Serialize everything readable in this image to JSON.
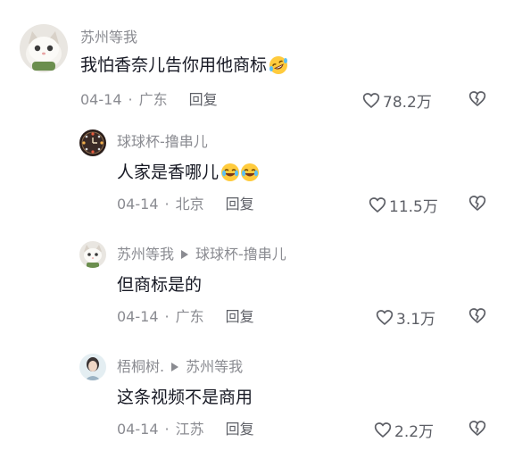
{
  "comments": [
    {
      "author": "苏州等我",
      "reply_to": "",
      "text": "我怕香奈儿告你用他商标",
      "emojis": [
        "rofl-emoji"
      ],
      "date": "04-14",
      "location": "广东",
      "reply_label": "回复",
      "likes": "78.2万"
    },
    {
      "author": "球球杯-撸串儿",
      "reply_to": "",
      "text": "人家是香哪儿",
      "emojis": [
        "crying-laughing-emoji",
        "crying-laughing-emoji"
      ],
      "date": "04-14",
      "location": "北京",
      "reply_label": "回复",
      "likes": "11.5万"
    },
    {
      "author": "苏州等我",
      "reply_to": "球球杯-撸串儿",
      "text": "但商标是的",
      "emojis": [],
      "date": "04-14",
      "location": "广东",
      "reply_label": "回复",
      "likes": "3.1万"
    },
    {
      "author": "梧桐树.",
      "reply_to": "苏州等我",
      "text": "这条视频不是商用",
      "emojis": [],
      "date": "04-14",
      "location": "江苏",
      "reply_label": "回复",
      "likes": "2.2万"
    }
  ],
  "separator": "·",
  "icons": {
    "like": "heart-outline-icon",
    "dislike": "broken-heart-icon",
    "reply_arrow": "play-triangle-icon"
  },
  "colors": {
    "text_primary": "#161823",
    "text_secondary": "#8a8b91",
    "action_gray": "#5d5f66"
  }
}
